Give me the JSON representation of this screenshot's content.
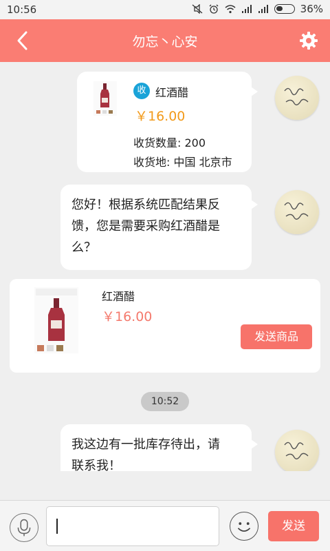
{
  "status_bar": {
    "time": "10:56",
    "battery": "36%"
  },
  "header": {
    "title": "勿忘丶心安"
  },
  "chat": {
    "product_message": {
      "badge": "收",
      "name": "红酒醋",
      "price": "￥16.00",
      "quantity": "收货数量: 200",
      "location": "收货地: 中国 北京市"
    },
    "message_1": [
      "您好！根据系统匹配结果反",
      "馈，您是需要采购红酒醋是",
      "么？"
    ],
    "product_card": {
      "name": "红酒醋",
      "price": "￥16.00",
      "send_label": "发送商品"
    },
    "time_chip": "10:52",
    "message_2": [
      "我这边有一批库存待出，请",
      "联系我！"
    ]
  },
  "input_bar": {
    "send_label": "发送"
  },
  "colors": {
    "accent": "#fa7d73",
    "price_orange": "#f29a1a",
    "badge_blue": "#1aa3d8"
  }
}
